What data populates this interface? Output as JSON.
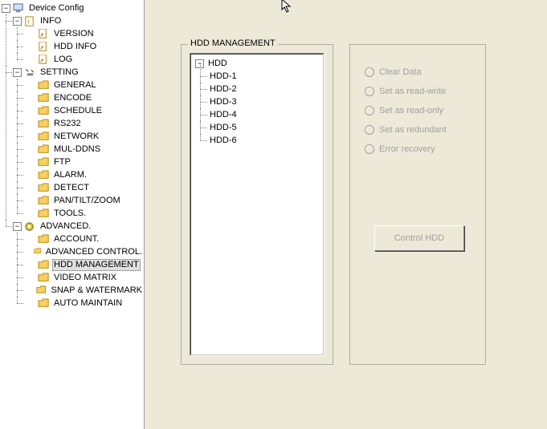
{
  "tree": {
    "root_label": "Device Config",
    "info_label": "INFO",
    "info_items": [
      "VERSION",
      "HDD INFO",
      "LOG"
    ],
    "setting_label": "SETTING",
    "setting_items": [
      "GENERAL",
      "ENCODE",
      "SCHEDULE",
      "RS232",
      "NETWORK",
      "MUL-DDNS",
      "FTP",
      "ALARM.",
      "DETECT",
      "PAN/TILT/ZOOM",
      "TOOLS."
    ],
    "advanced_label": "ADVANCED.",
    "advanced_items": [
      "ACCOUNT.",
      "ADVANCED CONTROL.",
      "HDD MANAGEMENT",
      "VIDEO MATRIX",
      "SNAP & WATERMARK",
      "AUTO MAINTAIN"
    ],
    "selected_path": "advanced.2"
  },
  "panel": {
    "title": "HDD MANAGEMENT",
    "hdd_root": "HDD",
    "hdd_items": [
      "HDD-1",
      "HDD-2",
      "HDD-3",
      "HDD-4",
      "HDD-5",
      "HDD-6"
    ],
    "actions": [
      "Clear Data",
      "Set as read-write",
      "Set as read-only",
      "Set as redundant",
      "Error recovery"
    ],
    "button_label": "Control HDD"
  },
  "glyph": {
    "minus": "−",
    "plus": "+"
  }
}
